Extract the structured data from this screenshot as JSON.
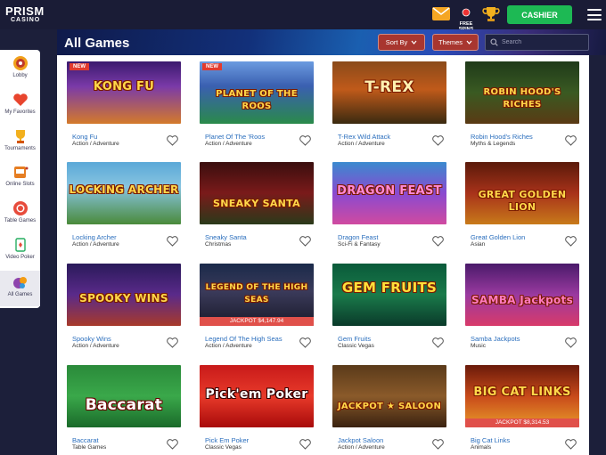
{
  "brand": {
    "line1": "PRISM",
    "line2": "CASINO"
  },
  "header": {
    "free_spins_label": "FREE SPINS",
    "cashier_label": "CASHIER"
  },
  "sidebar": {
    "items": [
      {
        "label": "Lobby",
        "icon": "lobby-icon"
      },
      {
        "label": "My Favorites",
        "icon": "heart-icon"
      },
      {
        "label": "Tournaments",
        "icon": "trophy-icon"
      },
      {
        "label": "Online Slots",
        "icon": "slot-machine-icon"
      },
      {
        "label": "Table Games",
        "icon": "poker-chip-icon"
      },
      {
        "label": "Video Poker",
        "icon": "playing-card-icon"
      },
      {
        "label": "All Games",
        "icon": "all-games-icon"
      }
    ],
    "active": "All Games"
  },
  "page": {
    "title": "All Games",
    "sort_label": "Sort By",
    "themes_label": "Themes",
    "search_placeholder": "Search"
  },
  "games": [
    {
      "name": "Kong Fu",
      "category": "Action / Adventure",
      "art": "KONG FU",
      "badge": "NEW",
      "jackpot": ""
    },
    {
      "name": "Planet Of The 'Roos",
      "category": "Action / Adventure",
      "art": "PLANET OF THE ROOS",
      "badge": "NEW",
      "jackpot": ""
    },
    {
      "name": "T-Rex Wild Attack",
      "category": "Action / Adventure",
      "art": "T-REX",
      "badge": "",
      "jackpot": ""
    },
    {
      "name": "Robin Hood's Riches",
      "category": "Myths & Legends",
      "art": "ROBIN HOOD'S RICHES",
      "badge": "",
      "jackpot": ""
    },
    {
      "name": "Locking Archer",
      "category": "Action / Adventure",
      "art": "LOCKING ARCHER",
      "badge": "",
      "jackpot": ""
    },
    {
      "name": "Sneaky Santa",
      "category": "Christmas",
      "art": "SNEAKY SANTA",
      "badge": "",
      "jackpot": ""
    },
    {
      "name": "Dragon Feast",
      "category": "Sci-Fi & Fantasy",
      "art": "DRAGON FEAST",
      "badge": "",
      "jackpot": ""
    },
    {
      "name": "Great Golden Lion",
      "category": "Asian",
      "art": "GREAT GOLDEN LION",
      "badge": "",
      "jackpot": ""
    },
    {
      "name": "Spooky Wins",
      "category": "Action / Adventure",
      "art": "SPOOKY WINS",
      "badge": "",
      "jackpot": ""
    },
    {
      "name": "Legend Of The High Seas",
      "category": "Action / Adventure",
      "art": "LEGEND OF THE HIGH SEAS",
      "badge": "",
      "jackpot": "JACKPOT $4,147.94"
    },
    {
      "name": "Gem Fruits",
      "category": "Classic Vegas",
      "art": "GEM FRUITS",
      "badge": "",
      "jackpot": ""
    },
    {
      "name": "Samba Jackpots",
      "category": "Music",
      "art": "SAMBA Jackpots",
      "badge": "",
      "jackpot": ""
    },
    {
      "name": "Baccarat",
      "category": "Table Games",
      "art": "Baccarat",
      "badge": "",
      "jackpot": ""
    },
    {
      "name": "Pick Em Poker",
      "category": "Classic Vegas",
      "art": "Pick'em Poker",
      "badge": "",
      "jackpot": ""
    },
    {
      "name": "Jackpot Saloon",
      "category": "Action / Adventure",
      "art": "JACKPOT ★ SALOON",
      "badge": "",
      "jackpot": ""
    },
    {
      "name": "Big Cat Links",
      "category": "Animals",
      "art": "BIG CAT LINKS",
      "badge": "",
      "jackpot": "JACKPOT $8,314.53"
    }
  ],
  "colors": {
    "accent": "#1db954",
    "button": "#a8362f",
    "link": "#2a6ebd",
    "background": "#1c1f3a"
  }
}
